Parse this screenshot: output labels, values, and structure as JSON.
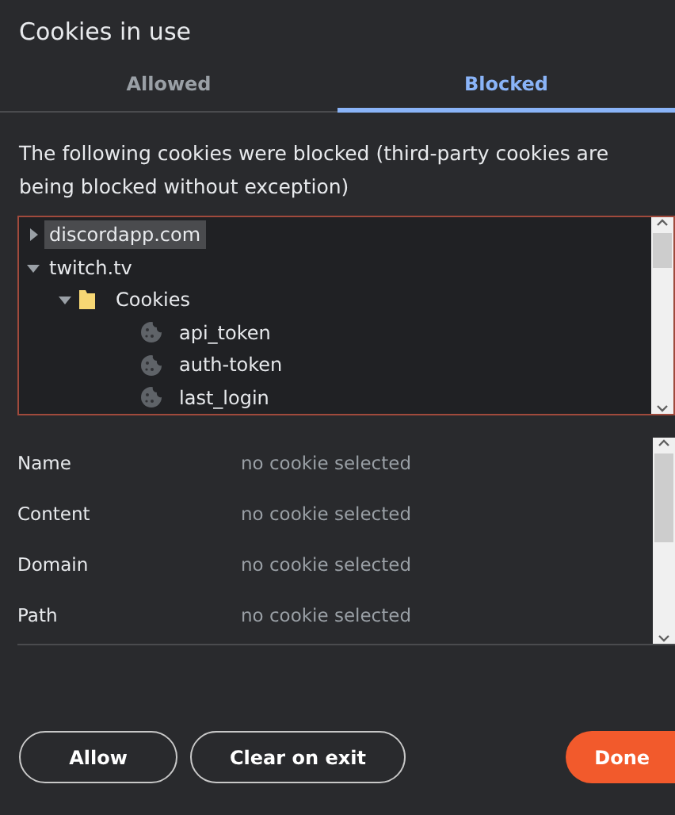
{
  "window": {
    "title": "Cookies in use"
  },
  "tabs": [
    {
      "label": "Allowed",
      "selected": false
    },
    {
      "label": "Blocked",
      "selected": true
    }
  ],
  "description": "The following cookies were blocked (third-party cookies are being blocked without exception)",
  "tree": [
    {
      "kind": "site",
      "label": "discordapp.com",
      "expanded": false,
      "selected": true
    },
    {
      "kind": "site",
      "label": "twitch.tv",
      "expanded": true,
      "selected": false,
      "children": [
        {
          "kind": "folder",
          "label": "Cookies",
          "expanded": true,
          "selected": false,
          "children": [
            {
              "kind": "cookie",
              "label": "api_token",
              "selected": false
            },
            {
              "kind": "cookie",
              "label": "auth-token",
              "selected": false
            },
            {
              "kind": "cookie",
              "label": "last_login",
              "selected": false
            }
          ]
        }
      ]
    }
  ],
  "details": [
    {
      "label": "Name",
      "value": "no cookie selected"
    },
    {
      "label": "Content",
      "value": "no cookie selected"
    },
    {
      "label": "Domain",
      "value": "no cookie selected"
    },
    {
      "label": "Path",
      "value": "no cookie selected"
    }
  ],
  "buttons": [
    {
      "label": "Allow",
      "kind": "outline"
    },
    {
      "label": "Clear on exit",
      "kind": "outline"
    },
    {
      "label": "Done",
      "kind": "primary"
    }
  ]
}
